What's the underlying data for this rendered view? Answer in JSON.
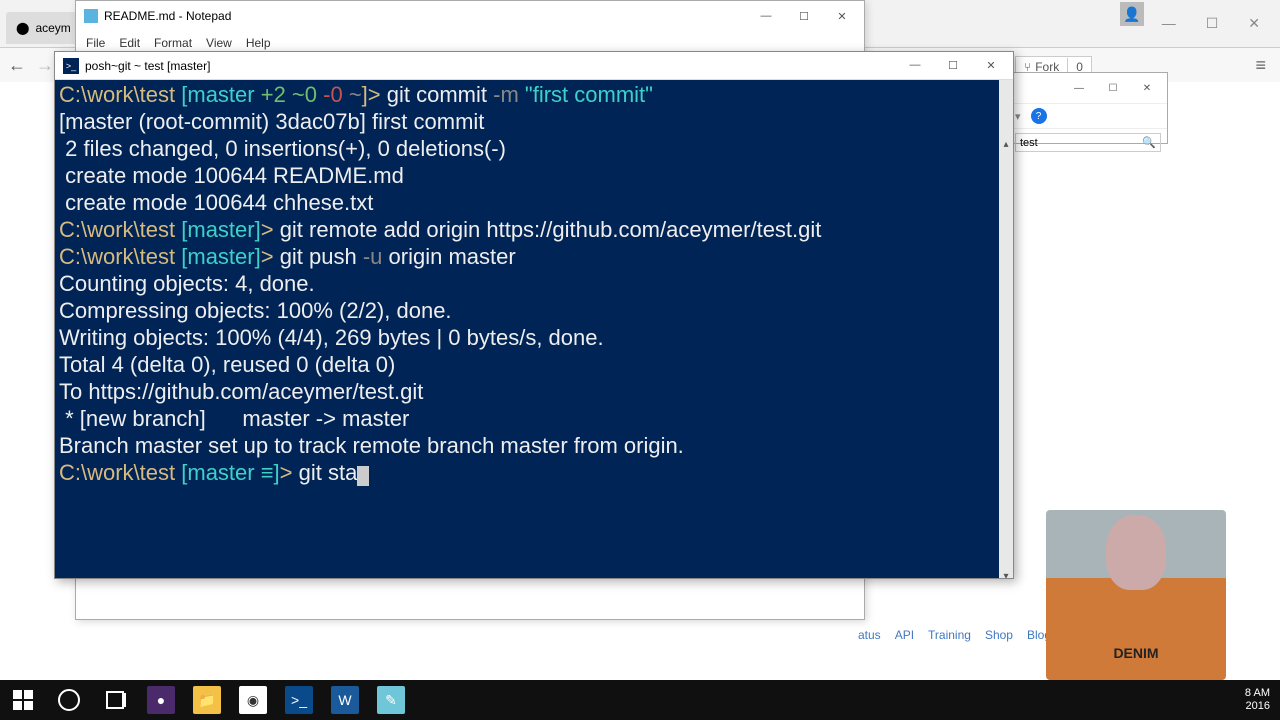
{
  "browser": {
    "tab_title": "aceym",
    "minus": "—",
    "square": "☐",
    "close": "✕"
  },
  "notepad": {
    "title": "README.md - Notepad",
    "menu": {
      "file": "File",
      "edit": "Edit",
      "format": "Format",
      "view": "View",
      "help": "Help"
    }
  },
  "terminal": {
    "title": "posh~git ~ test [master]",
    "line1_path": "C:\\work\\test ",
    "line1_branch_open": "[master ",
    "line1_plus": "+2 ",
    "line1_tilde0": "~0 ",
    "line1_minus0": "-0 ",
    "line1_tilde": "~",
    "line1_close": "]",
    "line1_gt": "> ",
    "line1_cmd": "git commit ",
    "line1_flag": "-m ",
    "line1_msg": "\"first commit\"",
    "out1": "[master (root-commit) 3dac07b] first commit",
    "out2": " 2 files changed, 0 insertions(+), 0 deletions(-)",
    "out3": " create mode 100644 README.md",
    "out4": " create mode 100644 chhese.txt",
    "line2_path": "C:\\work\\test ",
    "line2_branch": "[master]",
    "line2_gt": "> ",
    "line2_cmd": "git remote add origin https://github.com/aceymer/test.git",
    "line3_path": "C:\\work\\test ",
    "line3_branch": "[master]",
    "line3_gt": "> ",
    "line3_cmd_a": "git push ",
    "line3_flag": "-u",
    "line3_cmd_b": " origin master",
    "out5": "Counting objects: 4, done.",
    "out6": "Compressing objects: 100% (2/2), done.",
    "out7": "Writing objects: 100% (4/4), 269 bytes | 0 bytes/s, done.",
    "out8": "Total 4 (delta 0), reused 0 (delta 0)",
    "out9": "To https://github.com/aceymer/test.git",
    "out10": " * [new branch]      master -> master",
    "out11": "Branch master set up to track remote branch master from origin.",
    "line4_path": "C:\\work\\test ",
    "line4_branch": "[master ≡]",
    "line4_gt": "> ",
    "line4_cmd": "git sta"
  },
  "github": {
    "fork": "Fork",
    "fork_count": "0"
  },
  "explorer": {
    "search": "test",
    "help": "?"
  },
  "footer": {
    "status": "atus",
    "api": "API",
    "training": "Training",
    "shop": "Shop",
    "blog": "Blog"
  },
  "clock": {
    "time": "8 AM",
    "date": "2016"
  },
  "webcam": {
    "shirt": "DENIM"
  }
}
